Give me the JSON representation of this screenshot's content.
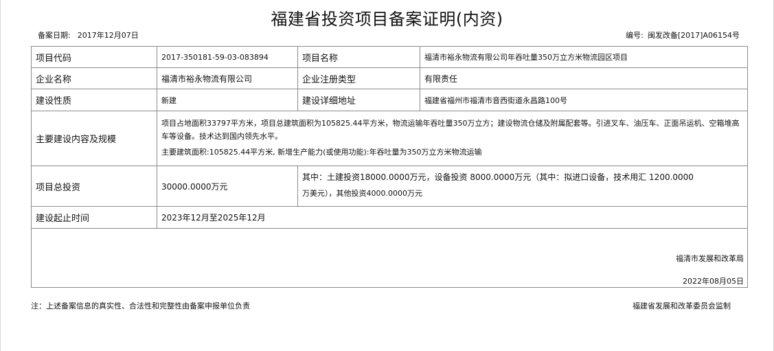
{
  "title": "福建省投资项目备案证明(内资)",
  "record_date": {
    "label": "备案日期:",
    "value": "2017年12月07日"
  },
  "serial": {
    "label": "编号:",
    "value": "闽发改备[2017]A06154号"
  },
  "fields": {
    "project_code": {
      "label": "项目代码",
      "value": "2017-350181-59-03-083894"
    },
    "project_name": {
      "label": "项目名称",
      "value": "福清市裕永物流有限公司年吞吐量350万立方米物流园区项目"
    },
    "company_name": {
      "label": "企业名称",
      "value": "福清市裕永物流有限公司"
    },
    "registration_type": {
      "label": "企业注册类型",
      "value": "有限责任"
    },
    "construction_nature": {
      "label": "建设性质",
      "value": "新建"
    },
    "address": {
      "label": "建设详细地址",
      "value": "福建省福州市福清市音西街道永昌路100号"
    },
    "main_content": {
      "label": "主要建设内容及规模",
      "line1": "项目占地面积33797平方米，项目总建筑面积为105825.44平方米，物流运输年吞吐量350万立方；建设物流仓储及附属配套等。引进叉车、油压车、正面吊运机、空箱堆高车等设备。技术达到国内领先水平。",
      "line2": "主要建筑面积:105825.44平方米, 新增生产能力(或使用功能):年吞吐量为350万立方米物流运输"
    },
    "total_investment": {
      "label": "项目总投资",
      "value": "30000.0000万元",
      "detail_line1": "其中：土建投资18000.0000万元，设备投资 8000.0000万元（其中：拟进口设备，技术用汇 1200.0000",
      "detail_line2": "万美元），其他投资4000.0000万元"
    },
    "period": {
      "label": "建设起止时间",
      "value": "2023年12月至2025年12月"
    }
  },
  "signature": {
    "organization": "福清市发展和改革局",
    "date": "2022年08月05日"
  },
  "footnote": "注：上述备案信息的真实性、合法性和完整性由备案申报单位负责",
  "supervision": "福建省发展和改革委员会监制"
}
